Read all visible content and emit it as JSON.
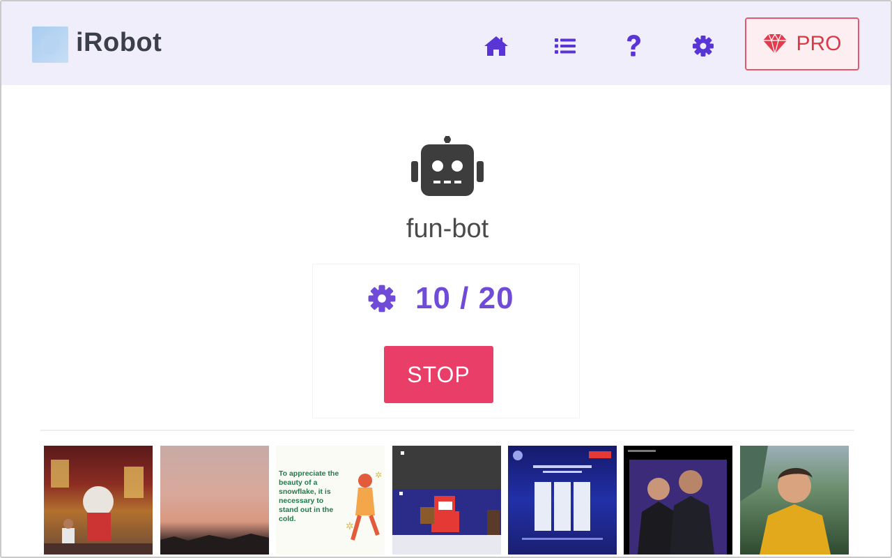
{
  "header": {
    "brand": "iRobot",
    "nav": [
      {
        "name": "home-icon"
      },
      {
        "name": "list-icon"
      },
      {
        "name": "help-icon"
      },
      {
        "name": "settings-icon"
      }
    ],
    "pro_label": "PRO",
    "accent_color": "#5a35d6",
    "pro_color": "#d93a4a"
  },
  "main": {
    "bot_icon": "robot-icon",
    "bot_name": "fun-bot",
    "progress": {
      "icon": "gear-icon",
      "current": 10,
      "total": 20,
      "text": "10 / 20"
    },
    "stop_label": "STOP",
    "stop_color": "#e83e68"
  },
  "thumbnails": {
    "snowflake_text": "To appreciate the beauty of a snowflake, it is necessary to stand out in the cold."
  }
}
